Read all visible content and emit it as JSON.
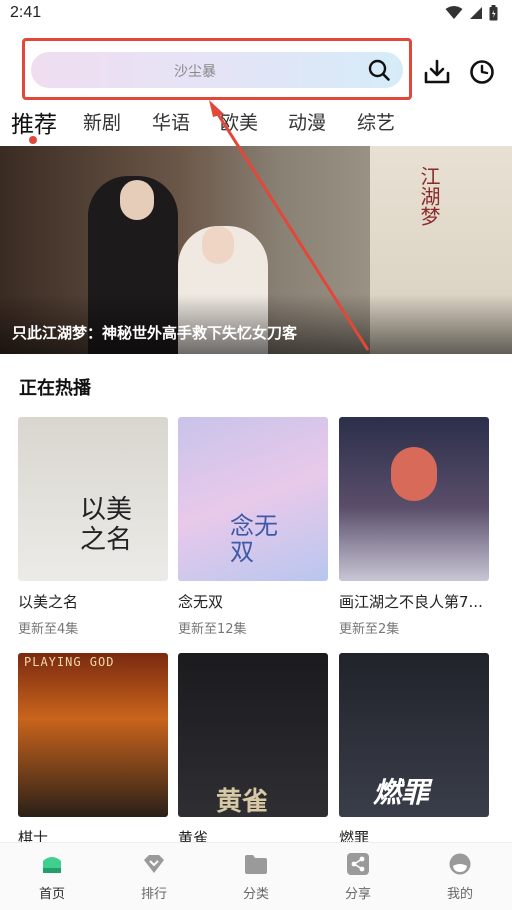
{
  "status_bar": {
    "time": "2:41"
  },
  "header": {
    "search_placeholder": "沙尘暴",
    "icons": [
      "search-icon",
      "download-icon",
      "history-icon"
    ],
    "highlight_color": "#e2483a"
  },
  "tabs": [
    {
      "label": "推荐",
      "active": true
    },
    {
      "label": "新剧"
    },
    {
      "label": "华语"
    },
    {
      "label": "欧美"
    },
    {
      "label": "动漫"
    },
    {
      "label": "综艺"
    }
  ],
  "banner": {
    "caption": "只此江湖梦：神秘世外高手救下失忆女刀客",
    "poster_text": "江湖梦"
  },
  "section": {
    "title": "正在热播",
    "items": [
      {
        "title": "以美之名",
        "update": "更新至4集",
        "art": "以美之名"
      },
      {
        "title": "念无双",
        "update": "更新至12集",
        "art": "念无双"
      },
      {
        "title": "画江湖之不良人第7...",
        "update": "更新至2集",
        "art": ""
      },
      {
        "title": "棋士",
        "update": "",
        "art": "PLAYING GOD"
      },
      {
        "title": "黄雀",
        "update": "",
        "art": "黄雀"
      },
      {
        "title": "燃罪",
        "update": "",
        "art": "燃罪"
      }
    ]
  },
  "bottom_nav": [
    {
      "label": "首页",
      "icon": "home-icon",
      "active": true
    },
    {
      "label": "排行",
      "icon": "ranking-icon"
    },
    {
      "label": "分类",
      "icon": "folder-icon"
    },
    {
      "label": "分享",
      "icon": "share-icon"
    },
    {
      "label": "我的",
      "icon": "profile-icon"
    }
  ],
  "colors": {
    "accent": "#e2483a",
    "active_nav": "#3fcf8e"
  }
}
